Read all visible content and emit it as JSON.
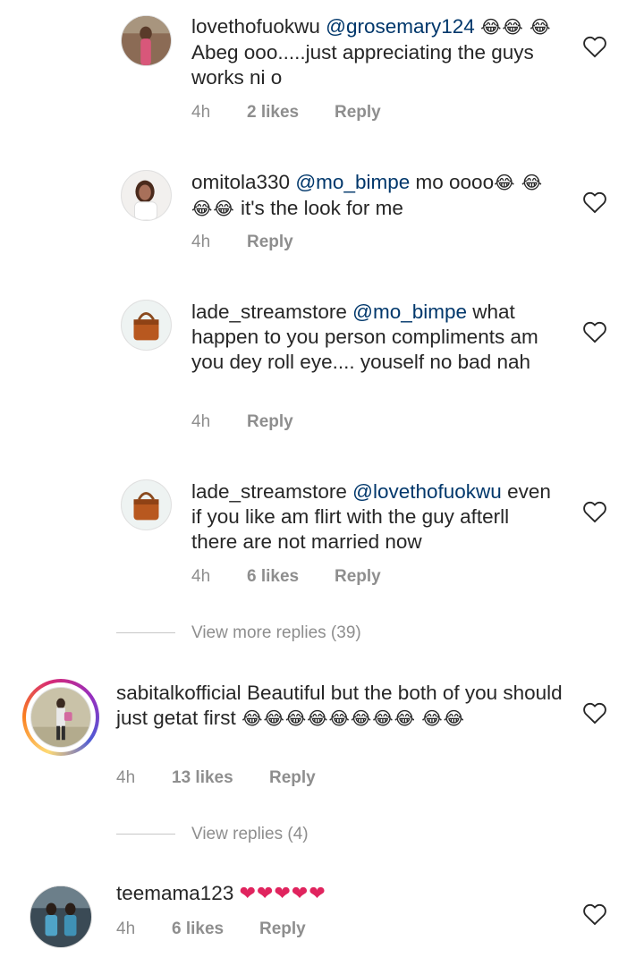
{
  "comments": [
    {
      "user": "lovethofuokwu",
      "mention": "@grosemary124",
      "emoji_a": "😂😂",
      "line2_emoji": "😂",
      "body": "Abeg ooo.....just appreciating the guys works ni o",
      "time": "4h",
      "likes": "2 likes",
      "reply": "Reply"
    },
    {
      "user": "omitola330",
      "mention": "@mo_bimpe",
      "body_a": "mo oooo",
      "emoji_a": "😂",
      "emoji_b": "😂😂😂",
      "body_b": "it's the look for me",
      "time": "4h",
      "reply": "Reply"
    },
    {
      "user": "lade_streamstore",
      "mention": "@mo_bimpe",
      "body": "what happen to you person compliments am you dey roll eye.... youself no bad nah",
      "time": "4h",
      "reply": "Reply"
    },
    {
      "user": "lade_streamstore",
      "mention": "@lovethofuokwu",
      "body": "even if you like am flirt with the guy afterll there are not married now",
      "time": "4h",
      "likes": "6 likes",
      "reply": "Reply"
    },
    {
      "user": "sabitalkofficial",
      "body": "Beautiful but the both of you should just getat first",
      "emoji_a": "😂😂😂😂😂😂😂😂",
      "emoji_b": "😂😂",
      "time": "4h",
      "likes": "13 likes",
      "reply": "Reply"
    },
    {
      "user": "teemama123",
      "hearts": "❤❤❤❤❤",
      "time": "4h",
      "likes": "6 likes",
      "reply": "Reply"
    }
  ],
  "view_more": "View more replies (39)",
  "view_replies": "View replies (4)",
  "icons": {
    "heart": "heart-outline-icon"
  },
  "colors": {
    "mention": "#00376b",
    "meta": "#8e8e8e",
    "heart_red": "#e0245e"
  }
}
